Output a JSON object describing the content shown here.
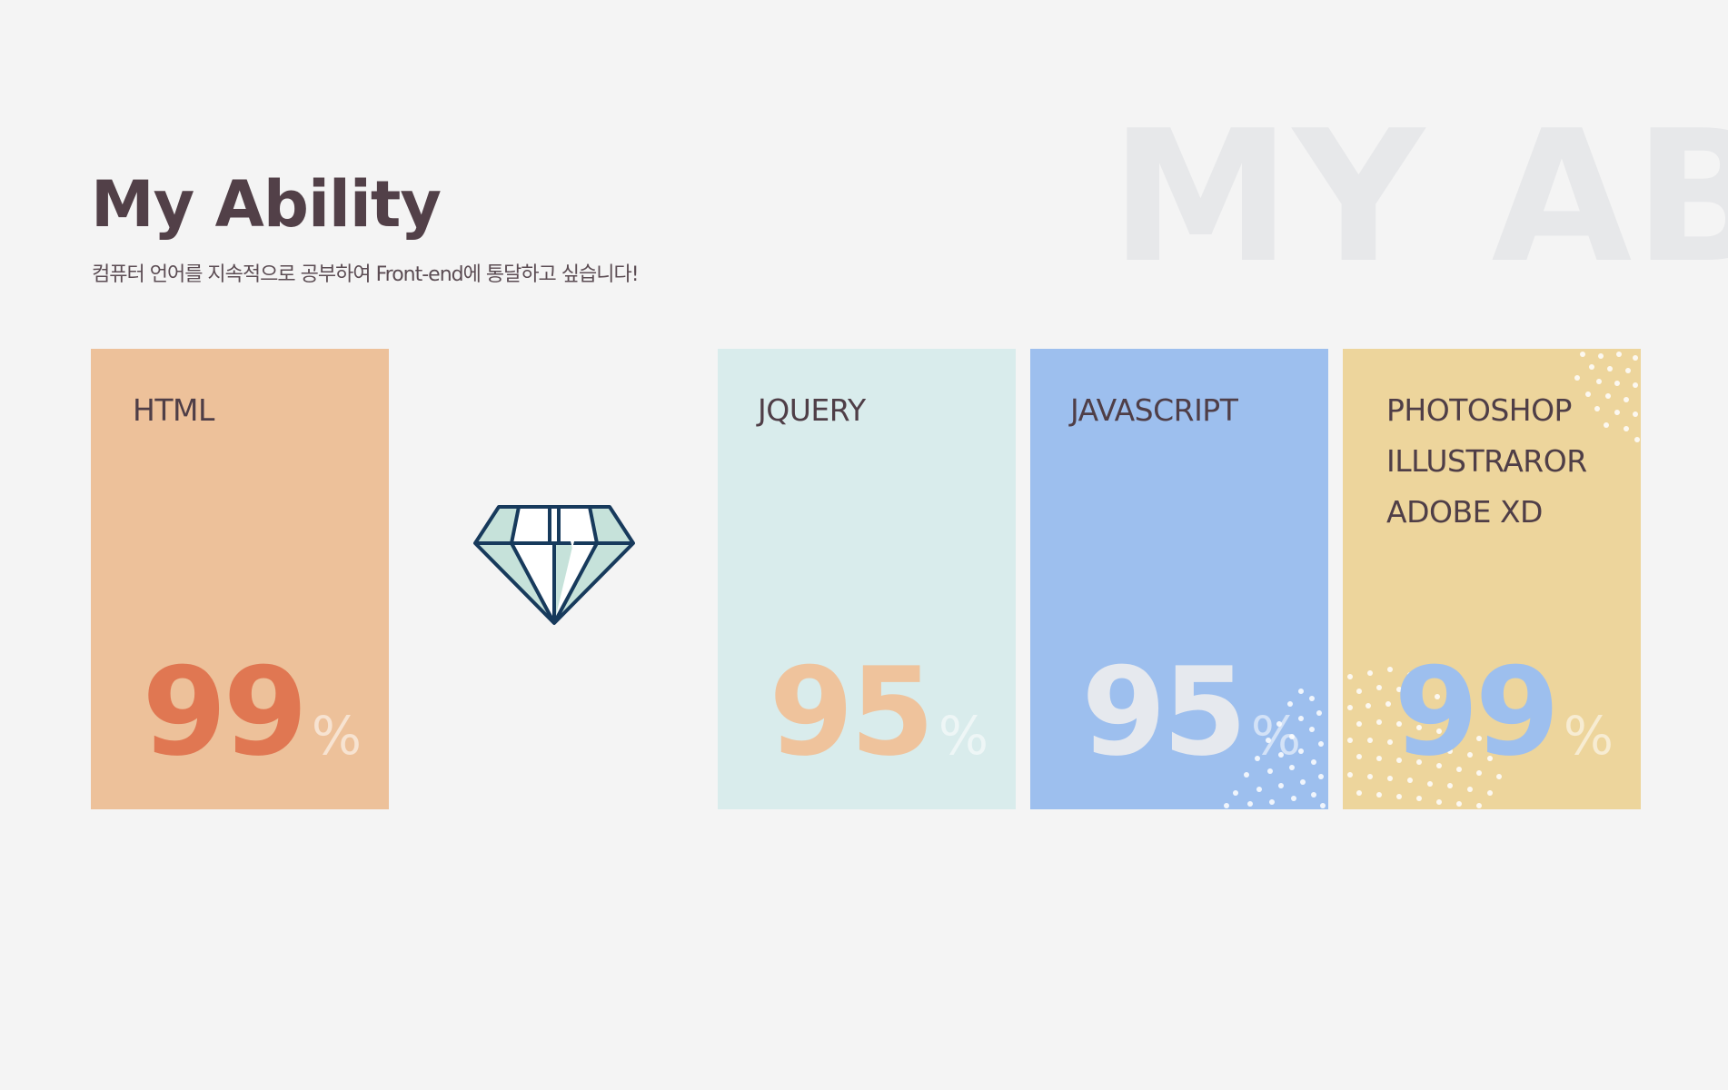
{
  "background_word": "MY ABILITY",
  "section": {
    "title": "My Ability",
    "subtitle": "컴퓨터 언어를 지속적으로 공부하여 Front-end에 통달하고 싶습니다!"
  },
  "cards": [
    {
      "labels": [
        "HTML"
      ],
      "value": "99",
      "unit": "%",
      "bg": "#edc19a",
      "number_color": "#e07752"
    },
    {
      "labels": [
        "JQUERY"
      ],
      "value": "95",
      "unit": "%",
      "bg": "#d9ecec",
      "number_color": "#efc39c"
    },
    {
      "labels": [
        "JAVASCRIPT"
      ],
      "value": "95",
      "unit": "%",
      "bg": "#9dbfee",
      "number_color": "#e6e9ee"
    },
    {
      "labels": [
        "PHOTOSHOP",
        "ILLUSTRAROR",
        "ADOBE XD"
      ],
      "value": "99",
      "unit": "%",
      "bg": "#edd59c",
      "number_color": "#9dbfee"
    }
  ],
  "icons": {
    "diamond": "diamond-icon"
  },
  "colors": {
    "page_bg": "#f4f4f4",
    "title": "#524048",
    "diamond_stroke": "#173a5c",
    "diamond_fill": "#c6e2da"
  }
}
